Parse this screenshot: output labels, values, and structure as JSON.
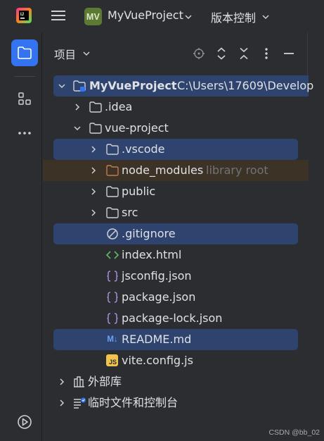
{
  "titlebar": {
    "project_badge": "MV",
    "project_name": "MyVueProject",
    "vcs_label": "版本控制"
  },
  "panel": {
    "title": "项目"
  },
  "tree": {
    "root": {
      "name": "MyVueProject",
      "path": "C:\\Users\\17609\\Develop"
    },
    "idea": ".idea",
    "vue_project": "vue-project",
    "vscode": ".vscode",
    "node_modules": "node_modules",
    "node_modules_hint": "library root",
    "public": "public",
    "src": "src",
    "gitignore": ".gitignore",
    "index_html": "index.html",
    "jsconfig": "jsconfig.json",
    "package": "package.json",
    "package_lock": "package-lock.json",
    "readme": "README.md",
    "vite_config": "vite.config.js",
    "external_libs": "外部库",
    "scratches": "临时文件和控制台"
  },
  "icons": {
    "md_badge": "M↓",
    "js_badge": "JS"
  },
  "colors": {
    "accent": "#3574f0",
    "selection": "#2e436e",
    "library_root_bg": "#3d3226",
    "folder_excluded": "#c27a55"
  },
  "watermark": "CSDN @bb_02"
}
